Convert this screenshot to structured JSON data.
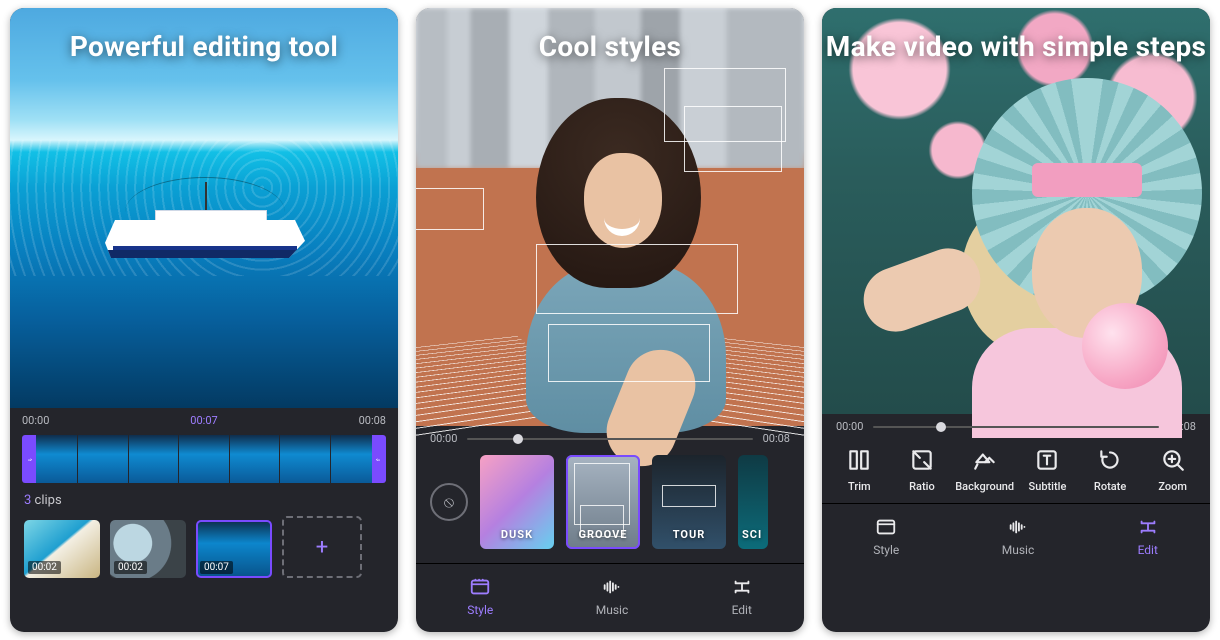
{
  "phone1": {
    "title": "Powerful editing tool",
    "time_start": "00:00",
    "time_now": "00:07",
    "time_end": "00:08",
    "clips_count": "3",
    "clips_word": "clips",
    "clips": [
      {
        "dur": "00:02"
      },
      {
        "dur": "00:02"
      },
      {
        "dur": "00:07"
      }
    ],
    "add": "+"
  },
  "phone2": {
    "title": "Cool styles",
    "time_start": "00:00",
    "time_end": "00:08",
    "nostyle_glyph": "⦸",
    "styles": [
      {
        "label": "DUSK"
      },
      {
        "label": "GROOVE"
      },
      {
        "label": "TOUR"
      },
      {
        "label": "SCI"
      }
    ],
    "tabs": {
      "style": "Style",
      "music": "Music",
      "edit": "Edit"
    }
  },
  "phone3": {
    "title": "Make video with simple steps",
    "time_start": "00:00",
    "time_end": "00:08",
    "tools": {
      "trim": "Trim",
      "ratio": "Ratio",
      "background": "Background",
      "subtitle": "Subtitle",
      "rotate": "Rotate",
      "zoom": "Zoom"
    },
    "tabs": {
      "style": "Style",
      "music": "Music",
      "edit": "Edit"
    }
  }
}
